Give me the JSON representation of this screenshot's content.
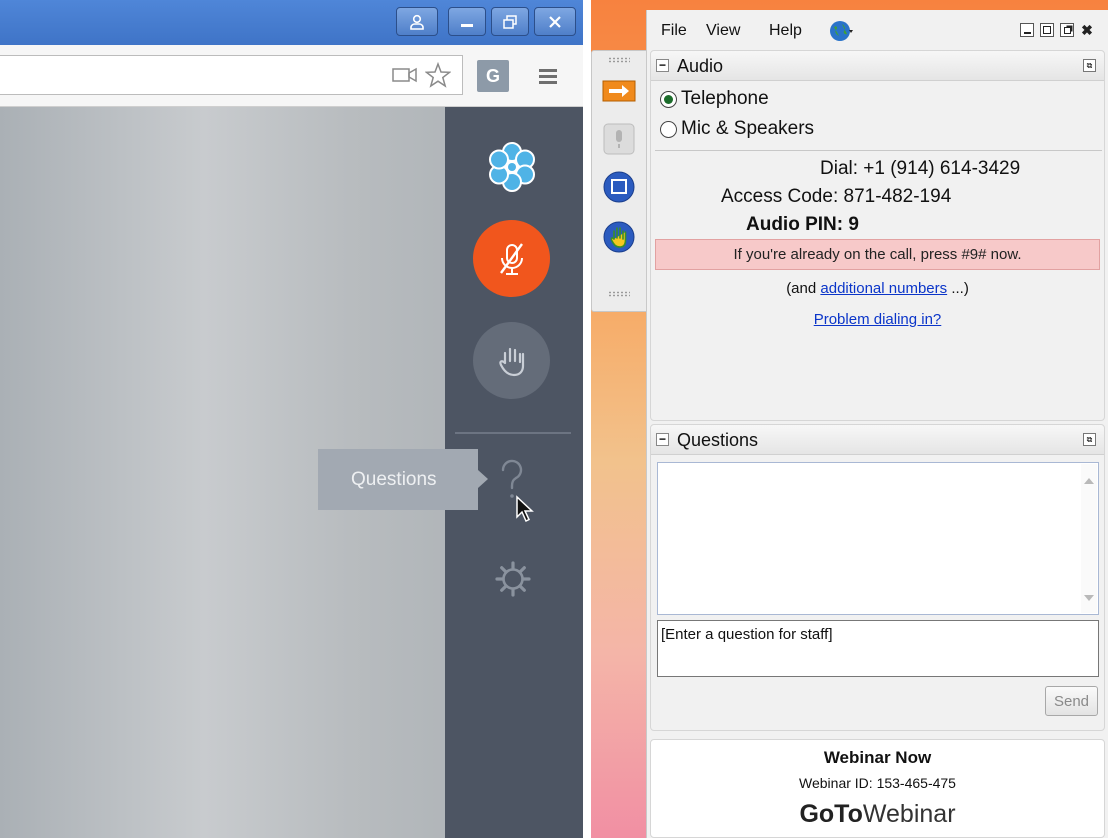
{
  "browser": {
    "tooltip": "Questions",
    "extension_letter": "G",
    "icons": [
      "profile-icon",
      "minimize-icon",
      "restore-icon",
      "close-icon",
      "camera-icon",
      "star-icon",
      "menu-icon",
      "flower-logo-icon",
      "mic-muted-icon",
      "hand-icon",
      "question-icon",
      "gear-icon",
      "cursor-icon"
    ],
    "colors": {
      "titlebar": "#4a80d3",
      "rail": "#4d5563",
      "mic_button": "#f1561d"
    }
  },
  "gtw": {
    "menu": {
      "file": "File",
      "view": "View",
      "help": "Help"
    },
    "audio": {
      "title": "Audio",
      "option_telephone": "Telephone",
      "option_mic": "Mic & Speakers",
      "selected": "Telephone",
      "dial": "Dial: +1 (914) 614-3429",
      "access_code": "Access Code: 871-482-194",
      "audio_pin": "Audio PIN: 9",
      "alert": "If you're already on the call, press #9# now.",
      "and_prefix": "(and",
      "additional_numbers": "additional numbers",
      "and_suffix": "...)",
      "problem_link": "Problem dialing in?"
    },
    "questions": {
      "title": "Questions",
      "input_value": "[Enter a question for staff]",
      "send": "Send"
    },
    "footer": {
      "webinar_name": "Webinar Now",
      "webinar_id": "Webinar ID: 153-465-475",
      "brand_bold": "GoTo",
      "brand_light": "Webinar"
    }
  }
}
